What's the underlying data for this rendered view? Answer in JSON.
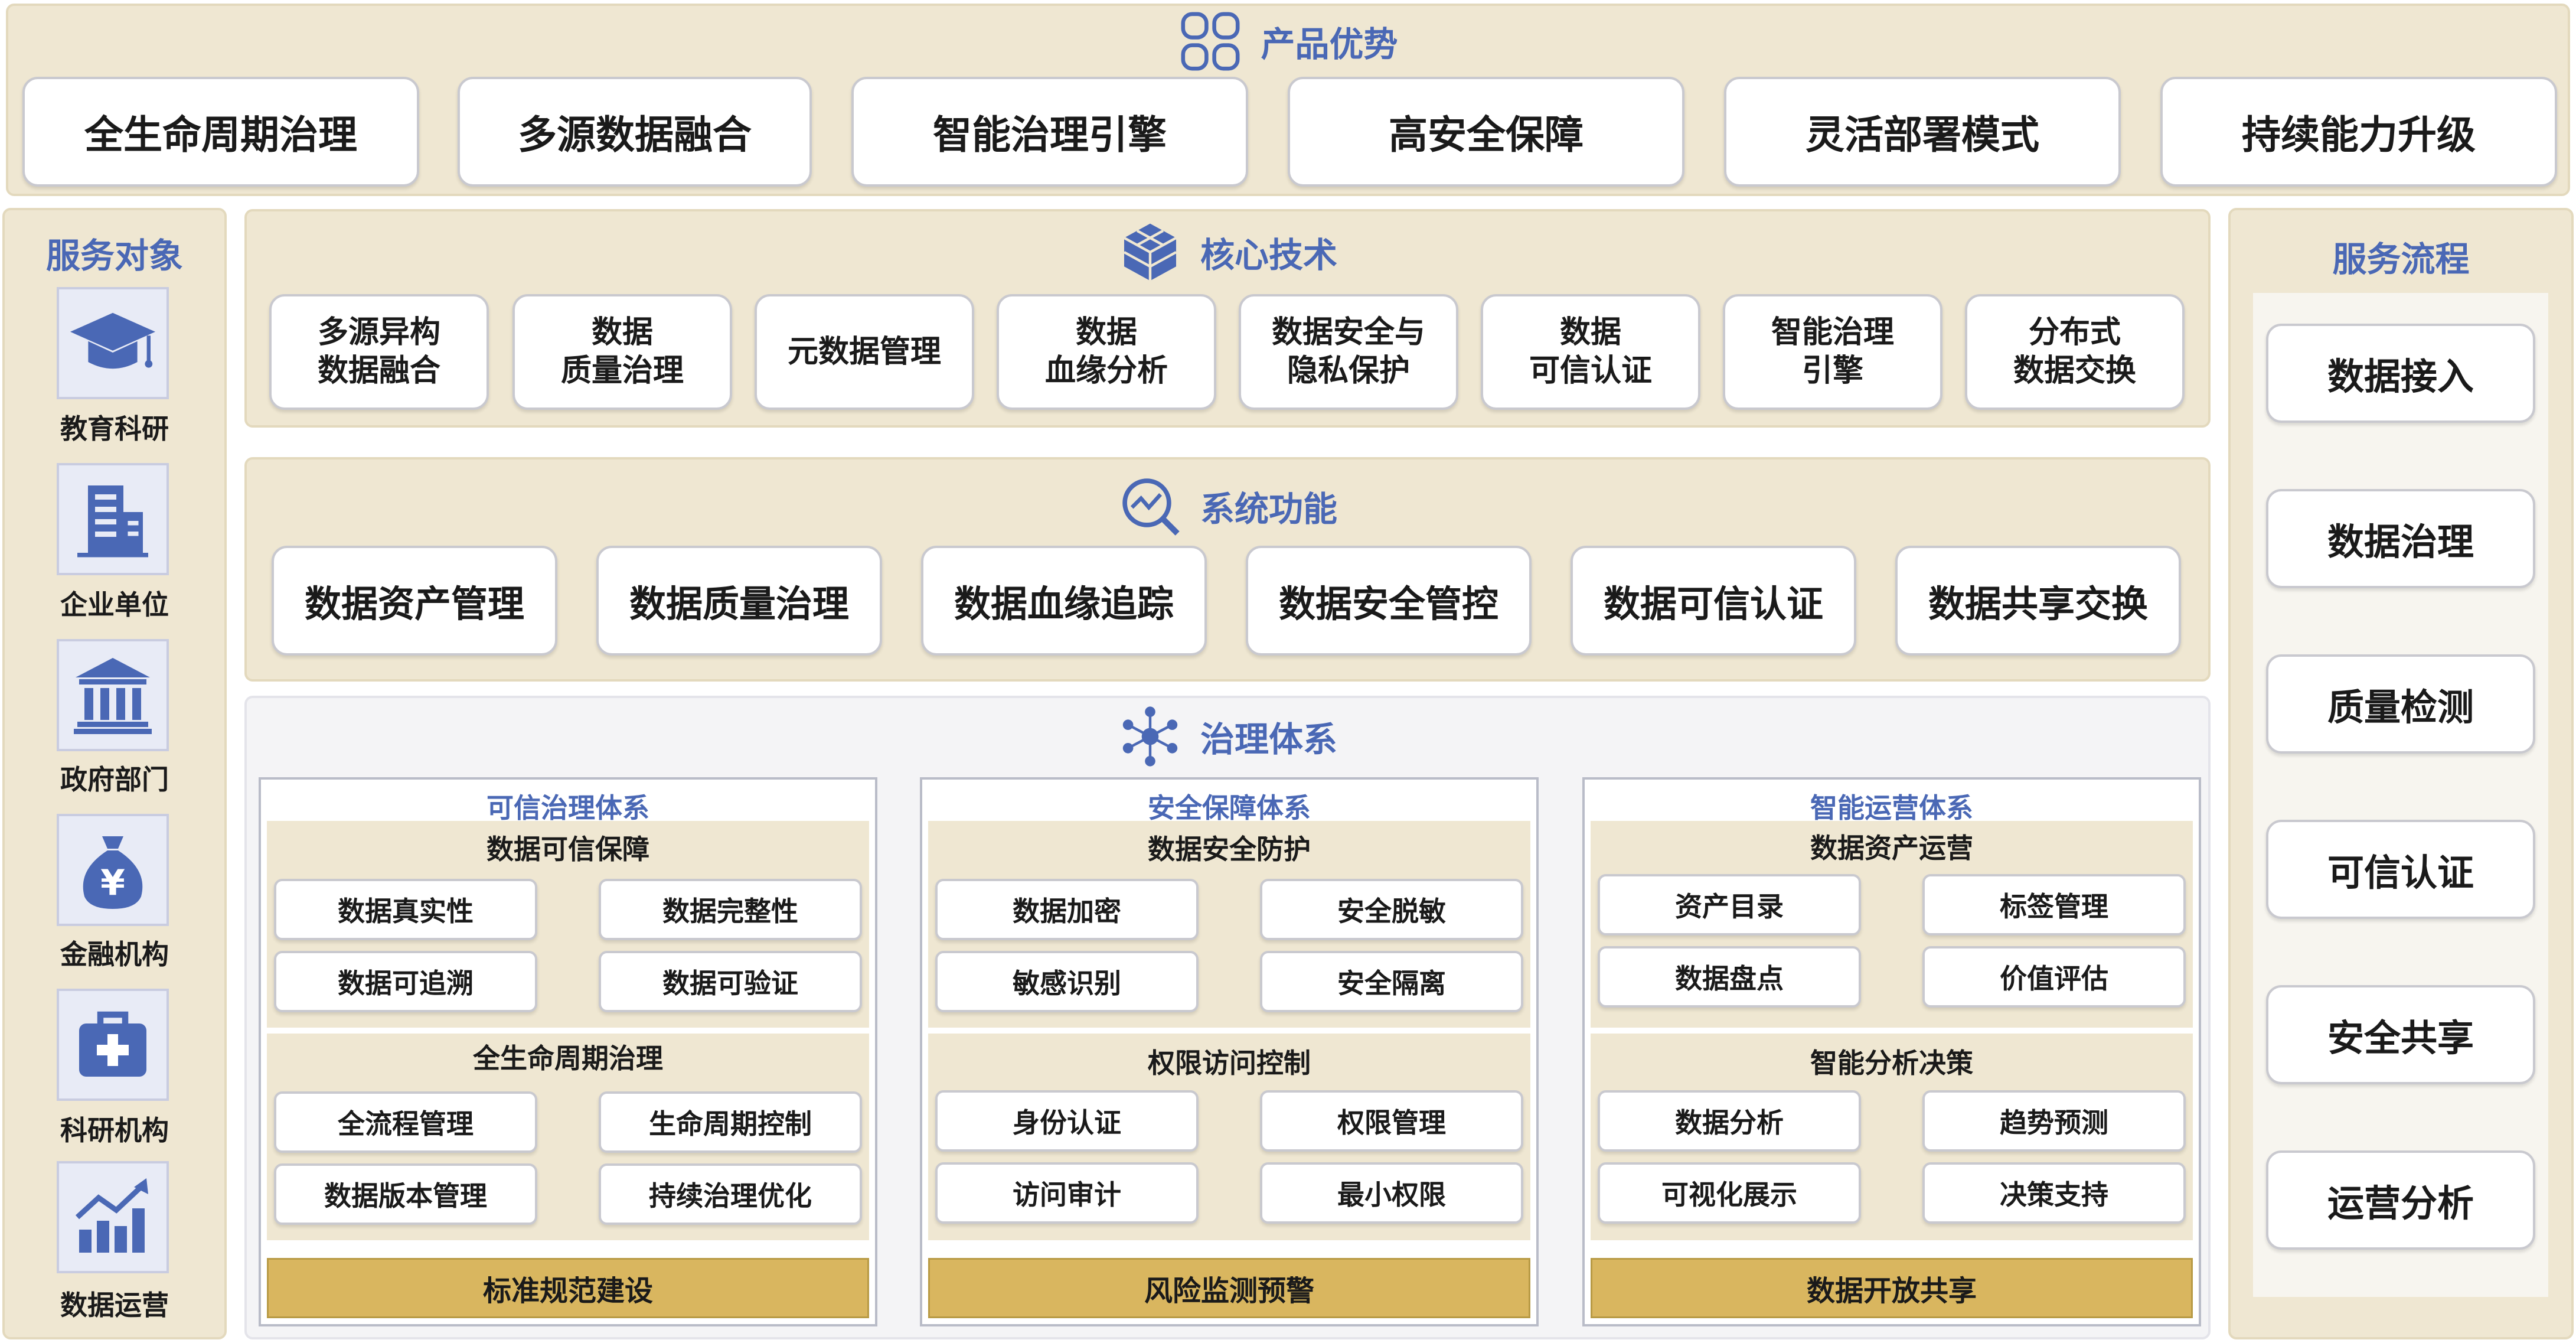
{
  "advantages": {
    "title": "产品优势",
    "icon": "grid-icon",
    "items": [
      "全生命周期治理",
      "多源数据融合",
      "智能治理引擎",
      "高安全保障",
      "灵活部署模式",
      "持续能力升级"
    ]
  },
  "service_targets": {
    "title": "服务对象",
    "items": [
      {
        "label": "教育科研",
        "icon": "graduation-cap-icon"
      },
      {
        "label": "企业单位",
        "icon": "building-icon"
      },
      {
        "label": "政府部门",
        "icon": "government-icon"
      },
      {
        "label": "金融机构",
        "icon": "money-bag-icon"
      },
      {
        "label": "科研机构",
        "icon": "medical-kit-icon"
      },
      {
        "label": "数据运营",
        "icon": "growth-chart-icon"
      }
    ]
  },
  "core_tech": {
    "title": "核心技术",
    "icon": "cube-icon",
    "items": [
      "多源异构\n数据融合",
      "数据\n质量治理",
      "元数据管理",
      "数据\n血缘分析",
      "数据安全与\n隐私保护",
      "数据\n可信认证",
      "智能治理\n引擎",
      "分布式\n数据交换"
    ]
  },
  "system_functions": {
    "title": "系统功能",
    "icon": "monitor-search-icon",
    "items": [
      "数据资产管理",
      "数据质量治理",
      "数据血缘追踪",
      "数据安全管控",
      "数据可信认证",
      "数据共享交换"
    ]
  },
  "governance": {
    "title": "治理体系",
    "icon": "network-icon",
    "systems": [
      {
        "title": "可信治理体系",
        "groups": [
          {
            "title": "数据可信保障",
            "items": [
              "数据真实性",
              "数据完整性",
              "数据可追溯",
              "数据可验证"
            ]
          },
          {
            "title": "全生命周期治理",
            "items": [
              "全流程管理",
              "生命周期控制",
              "数据版本管理",
              "持续治理优化"
            ]
          }
        ],
        "footer": "标准规范建设"
      },
      {
        "title": "安全保障体系",
        "groups": [
          {
            "title": "数据安全防护",
            "items": [
              "数据加密",
              "安全脱敏",
              "敏感识别",
              "安全隔离"
            ]
          },
          {
            "title": "权限访问控制",
            "items": [
              "身份认证",
              "权限管理",
              "访问审计",
              "最小权限"
            ]
          }
        ],
        "footer": "风险监测预警"
      },
      {
        "title": "智能运营体系",
        "groups": [
          {
            "title": "数据资产运营",
            "items": [
              "资产目录",
              "标签管理",
              "数据盘点",
              "价值评估"
            ]
          },
          {
            "title": "智能分析决策",
            "items": [
              "数据分析",
              "趋势预测",
              "可视化展示",
              "决策支持"
            ]
          }
        ],
        "footer": "数据开放共享"
      }
    ]
  },
  "service_flow": {
    "title": "服务流程",
    "items": [
      "数据接入",
      "数据治理",
      "质量检测",
      "可信认证",
      "安全共享",
      "运营分析"
    ]
  },
  "colors": {
    "panel": "#efe7d2",
    "accent": "#4a68b5",
    "gold": "#d9b65f"
  }
}
